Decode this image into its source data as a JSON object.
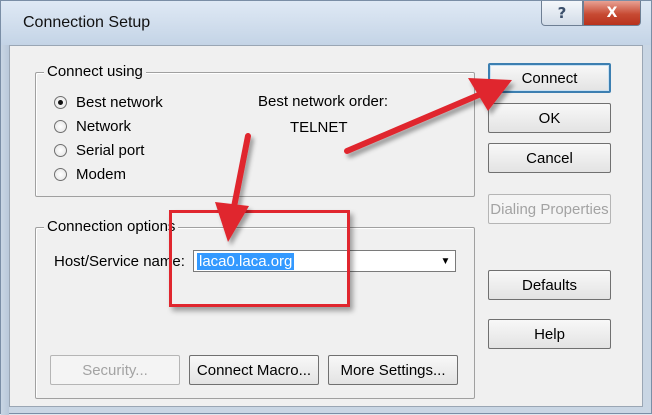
{
  "window": {
    "title": "Connection Setup",
    "help_glyph": "?",
    "close_glyph": "X"
  },
  "connect_using": {
    "legend": "Connect using",
    "options": [
      {
        "label": "Best network",
        "checked": true
      },
      {
        "label": "Network",
        "checked": false
      },
      {
        "label": "Serial port",
        "checked": false
      },
      {
        "label": "Modem",
        "checked": false
      }
    ],
    "best_network_order_label": "Best network order:",
    "best_network_order_value": "TELNET"
  },
  "connection_options": {
    "legend": "Connection options",
    "host_label": "Host/Service name:",
    "host_value": "laca0.laca.org",
    "dropdown_glyph": "▼"
  },
  "buttons": {
    "connect": "Connect",
    "ok": "OK",
    "cancel": "Cancel",
    "dialing_properties": "Dialing Properties",
    "defaults": "Defaults",
    "help": "Help",
    "security": "Security...",
    "connect_macro": "Connect Macro...",
    "more_settings": "More Settings..."
  },
  "colors": {
    "annotation_red": "#e0262e",
    "selection_blue": "#3399ff",
    "focus_border": "#3c7fb1"
  }
}
